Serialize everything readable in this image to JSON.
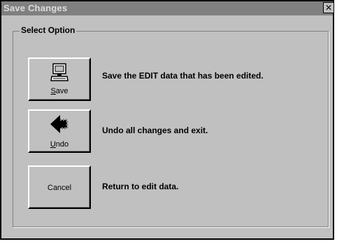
{
  "window": {
    "title": "Save Changes",
    "close_glyph": "✕"
  },
  "group": {
    "label": "Select Option"
  },
  "options": [
    {
      "button_label_first": "S",
      "button_label_rest": "ave",
      "icon": "computer-icon",
      "description": "Save the EDIT data that has been edited."
    },
    {
      "button_label_first": "U",
      "button_label_rest": "ndo",
      "icon": "undo-arrow-icon",
      "description": "Undo all changes and exit."
    },
    {
      "button_label": "Cancel",
      "description": "Return to edit data."
    }
  ]
}
